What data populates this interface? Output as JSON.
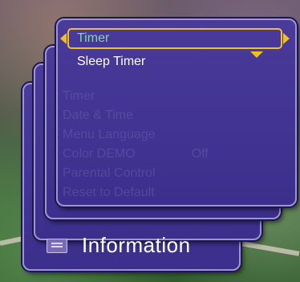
{
  "menu": {
    "selected_label": "Timer",
    "items": [
      "Sleep Timer"
    ]
  },
  "background_menu": {
    "faded_items": [
      "Timer",
      "Date & Time",
      "Menu Language",
      "Color DEMO",
      "Parental Control",
      "Reset to Default"
    ],
    "faded_value": "Off",
    "info_label": "Information"
  },
  "colors": {
    "panel": "#3c2f8c",
    "highlight": "#f0c020",
    "selected_text": "#7fd8a0"
  },
  "icons": {
    "left_arrow": "triangle-left",
    "right_arrow": "triangle-right",
    "down_arrow": "triangle-down",
    "info": "information-icon"
  }
}
